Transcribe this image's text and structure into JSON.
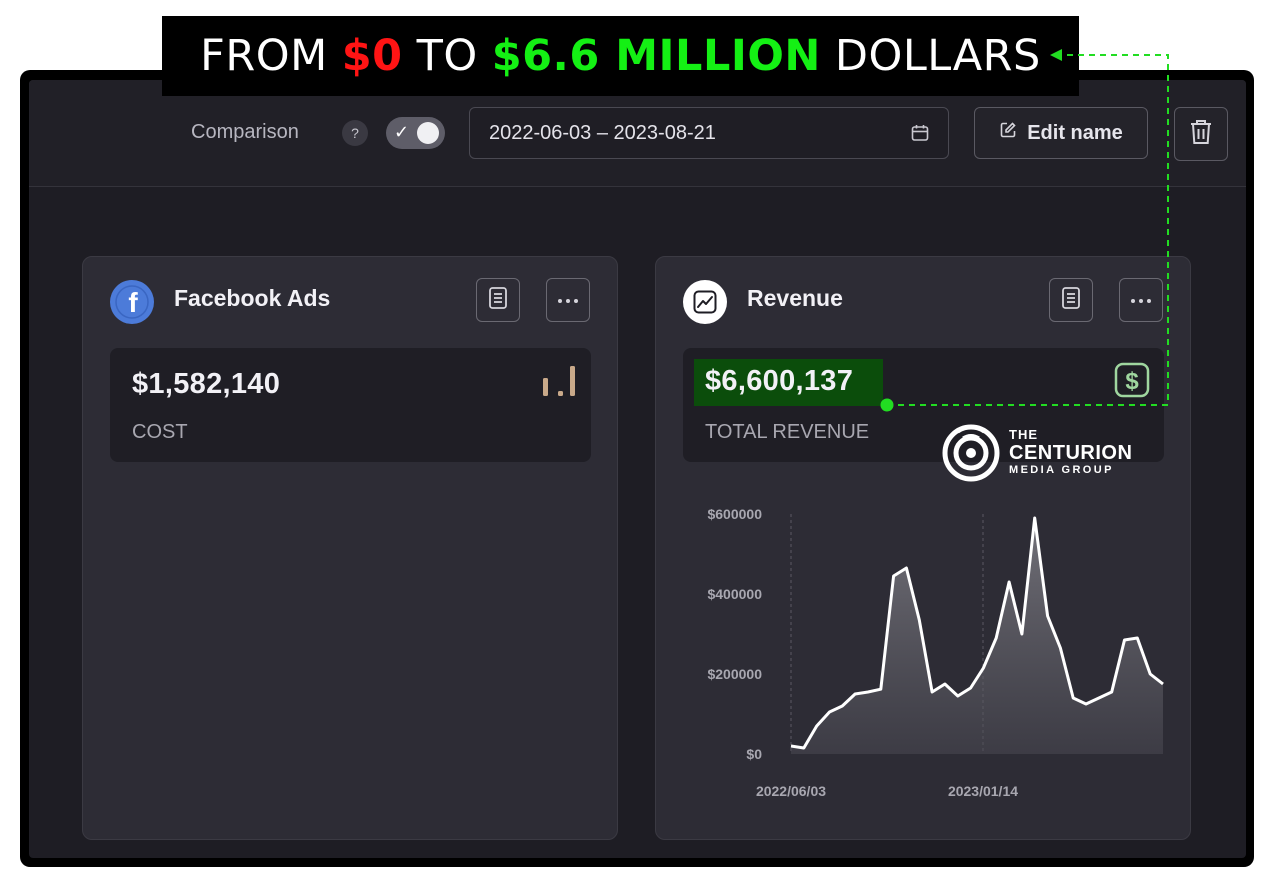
{
  "banner": {
    "part1": "FROM",
    "part2": "$0",
    "part3": "TO",
    "part4": "$6.6 MILLION",
    "part5": "DOLLARS"
  },
  "toolbar": {
    "comparison_label": "Comparison",
    "help_glyph": "?",
    "comparison_enabled": true,
    "date_range": "2022-06-03 – 2023-08-21",
    "edit_name_label": "Edit name"
  },
  "facebook_card": {
    "title": "Facebook Ads",
    "stat_value": "$1,582,140",
    "stat_label": "COST"
  },
  "revenue_card": {
    "title": "Revenue",
    "stat_value": "$6,600,137",
    "stat_label": "TOTAL REVENUE"
  },
  "watermark": {
    "line1": "THE",
    "line2": "CENTURION",
    "line3": "MEDIA GROUP"
  },
  "colors": {
    "banner_red": "#ff1414",
    "banner_green": "#14f014",
    "highlight_green": "#0b4d0b",
    "annotation_green": "#22dd22",
    "facebook_blue": "#4c7bd9",
    "bar_icon_tan": "#c9a98a",
    "dollar_icon_green": "#9fd69f"
  },
  "chart_data": {
    "type": "area",
    "title": "",
    "xlabel": "",
    "ylabel": "",
    "ylim": [
      0,
      600000
    ],
    "y_ticks": [
      "$600000",
      "$400000",
      "$200000",
      "$0"
    ],
    "x_ticks": [
      "2022/06/03",
      "2023/01/14"
    ],
    "grid": "vertical dashed lines at x tick dates",
    "series": [
      {
        "values": [
          20000,
          15000,
          70000,
          105000,
          120000,
          150000,
          155000,
          162000,
          445000,
          465000,
          335000,
          155000,
          175000,
          145000,
          165000,
          215000,
          290000,
          430000,
          300000,
          590000,
          345000,
          265000,
          140000,
          125000,
          140000,
          155000,
          285000,
          290000,
          200000,
          175000
        ]
      }
    ]
  }
}
